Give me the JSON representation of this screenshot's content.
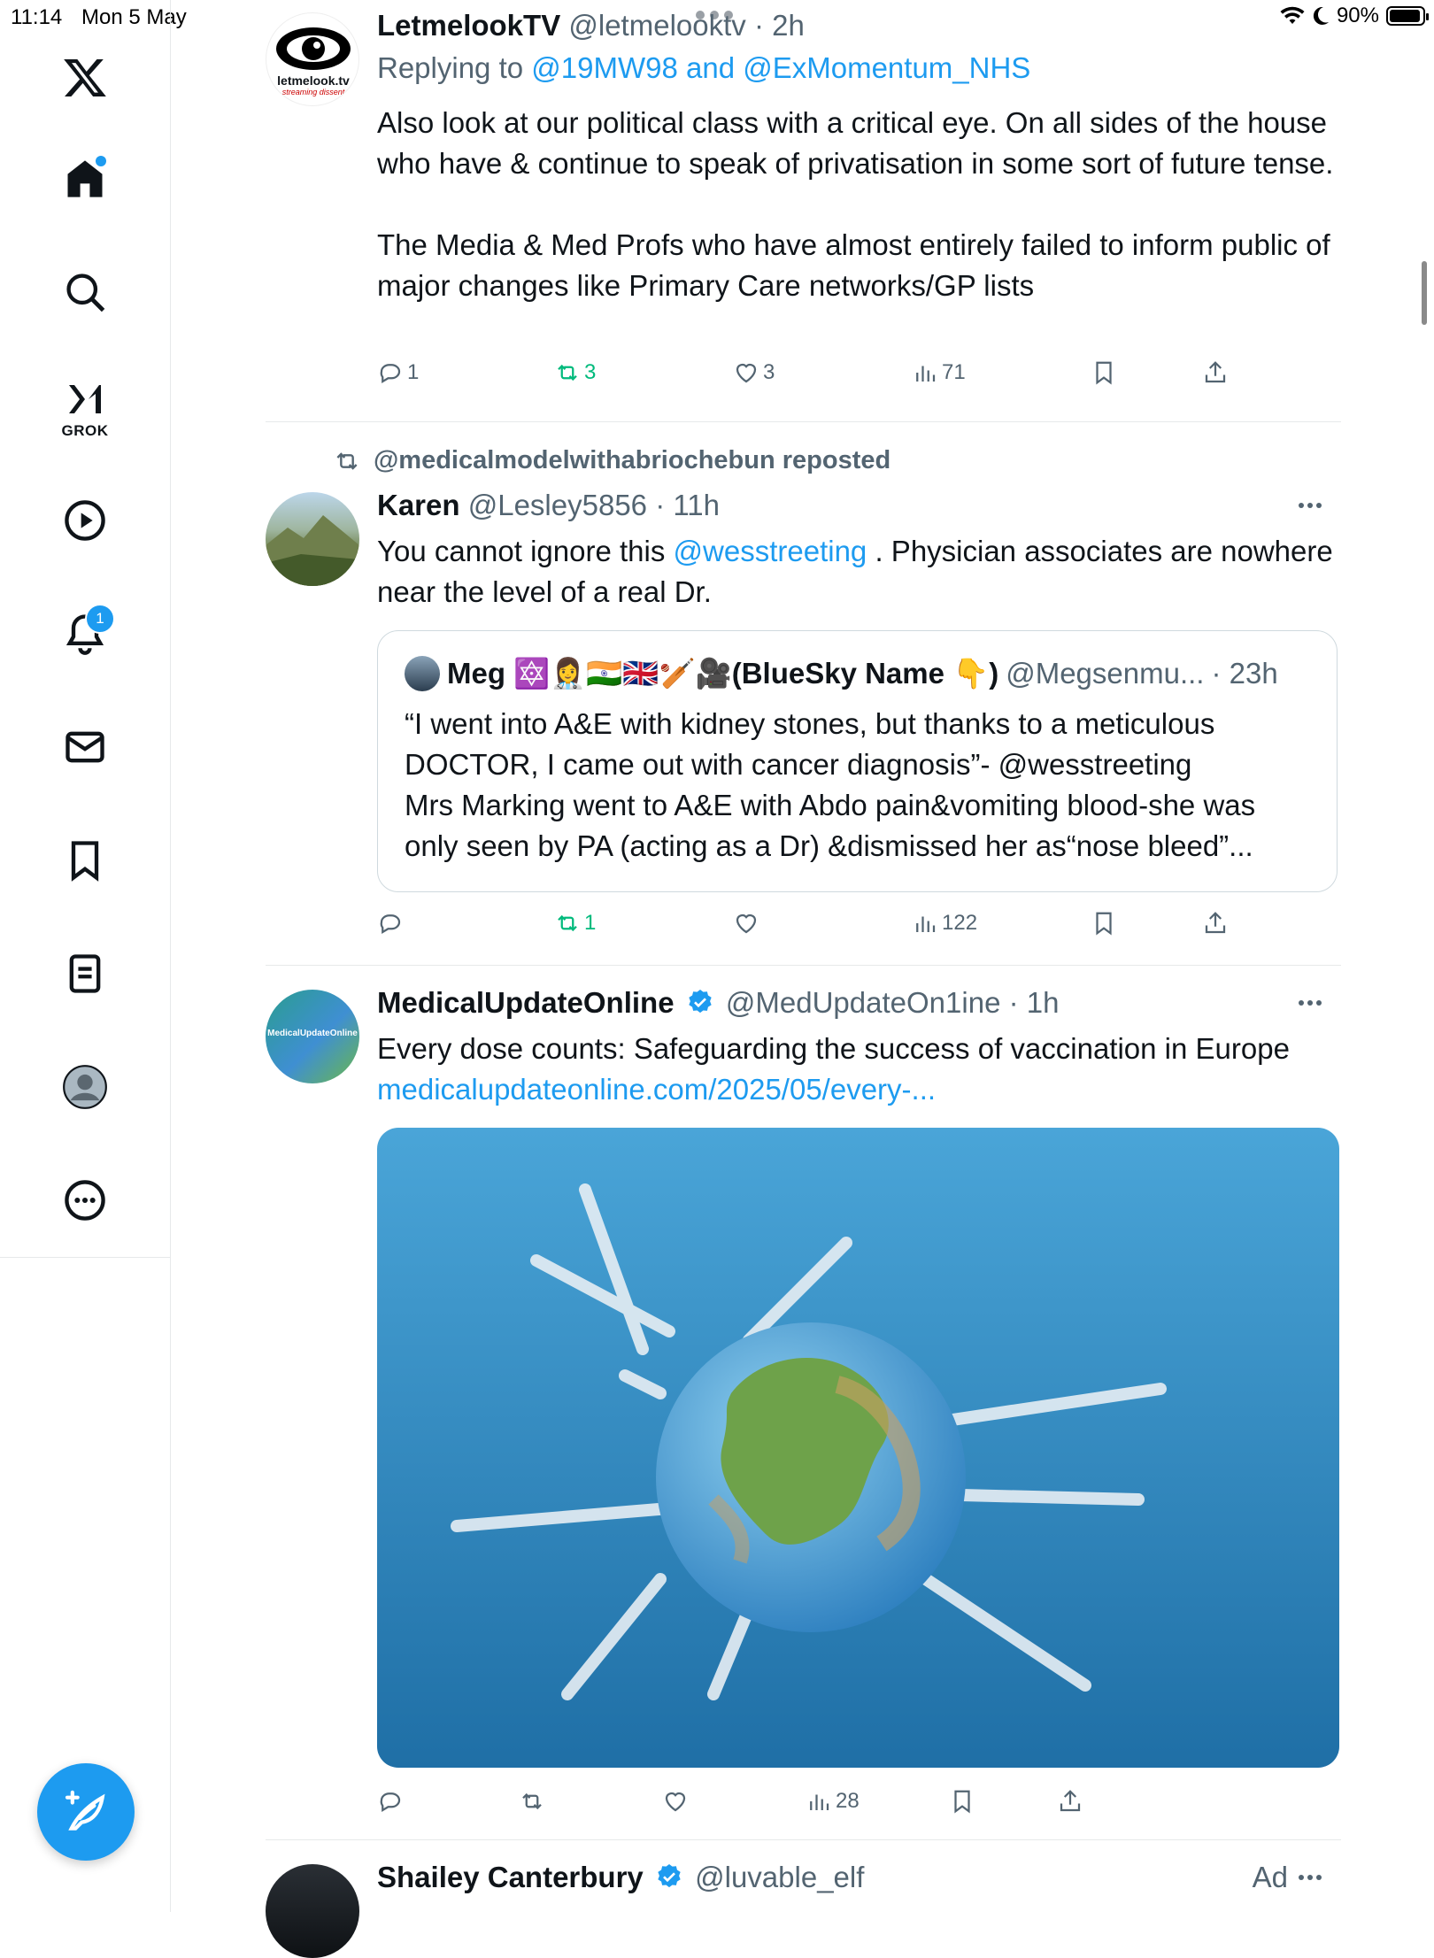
{
  "status_bar": {
    "time": "11:14",
    "date": "Mon 5 May",
    "battery": "90%"
  },
  "sidebar": {
    "grok_label": "GROK",
    "notification_count": "1"
  },
  "tweets": [
    {
      "name": "LetmelookTV",
      "handle": "@letmelooktv",
      "time": "· 2h",
      "avatar_text": "letmelook.tv",
      "avatar_subtext": "streaming dissent",
      "replying_prefix": "Replying to",
      "replying_to": "@19MW98 and @ExMomentum_NHS",
      "text": "Also look at our political class with a critical eye. On all sides of the house who have & continue to speak of privatisation in some sort of future tense.\n\nThe Media & Med Profs who have almost entirely failed to inform public of major changes like Primary Care networks/GP lists",
      "replies": "1",
      "reposts": "3",
      "likes": "3",
      "views": "71"
    },
    {
      "repost_by": "@medicalmodelwithabriochebun reposted",
      "name": "Karen",
      "handle": "@Lesley5856",
      "time": "· 11h",
      "text_before": "You cannot ignore this ",
      "mention": "@wesstreeting",
      "text_after": " . Physician associates are nowhere near the level of a real Dr.",
      "quote": {
        "name": "Meg 🔯👩‍⚕️🇮🇳🇬🇧🏏🎥(BlueSky Name 👇)",
        "handle": "@Megsenmu...",
        "time": "· 23h",
        "text": "“I went into A&E with kidney stones, but thanks to a meticulous DOCTOR, I came out with cancer diagnosis”- @wesstreeting\nMrs Marking went to A&E with Abdo pain&vomiting blood-she was only seen by PA (acting as a Dr) &dismissed her as“nose bleed”..."
      },
      "replies": "",
      "reposts": "1",
      "likes": "",
      "views": "122"
    },
    {
      "name": "MedicalUpdateOnline",
      "handle": "@MedUpdateOn1ine",
      "time": "· 1h",
      "avatar_text": "MedicalUpdateOnline",
      "text": "Every dose counts: Safeguarding the success of vaccination in Europe",
      "link": "medicalupdateonline.com/2025/05/every-...",
      "replies": "",
      "reposts": "",
      "likes": "",
      "views": "28"
    },
    {
      "name": "Shailey Canterbury",
      "handle": "@luvable_elf",
      "ad": "Ad"
    }
  ],
  "colors": {
    "accent": "#1d9bf0",
    "repost_green": "#00ba7c",
    "secondary_text": "#536471"
  }
}
